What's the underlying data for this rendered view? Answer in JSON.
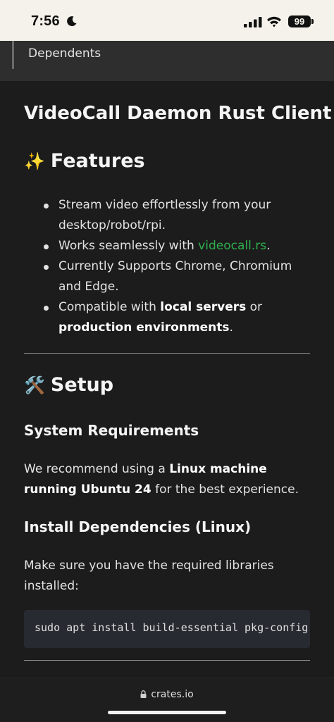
{
  "status_bar": {
    "time": "7:56",
    "battery": "99"
  },
  "dependents_bar": {
    "label": "Dependents"
  },
  "readme": {
    "title": "VideoCall Daemon Rust Client",
    "features": {
      "emoji": "✨",
      "heading": "Features",
      "items": [
        {
          "text": "Stream video effortlessly from your desktop/robot/rpi."
        },
        {
          "before": "Works seamlessly with ",
          "link": "videocall.rs",
          "after": "."
        },
        {
          "text": "Currently Supports Chrome, Chromium and Edge."
        },
        {
          "before": "Compatible with ",
          "bold1": "local servers",
          "middle": " or ",
          "bold2": "production environments",
          "after": "."
        }
      ]
    },
    "setup": {
      "emoji": "🛠️",
      "heading": "Setup",
      "system_requirements": {
        "heading": "System Requirements",
        "before": "We recommend using a ",
        "bold": "Linux machine running Ubuntu 24",
        "after": " for the best experience."
      },
      "install": {
        "heading": "Install Dependencies (Linux)",
        "text": "Make sure you have the required libraries installed:",
        "code": "sudo apt install build-essential pkg-config libclang-dev"
      }
    }
  },
  "browser": {
    "url": "crates.io"
  },
  "colors": {
    "link": "#2fae4e",
    "background": "#1c1c1c",
    "code_background": "#272a30"
  }
}
